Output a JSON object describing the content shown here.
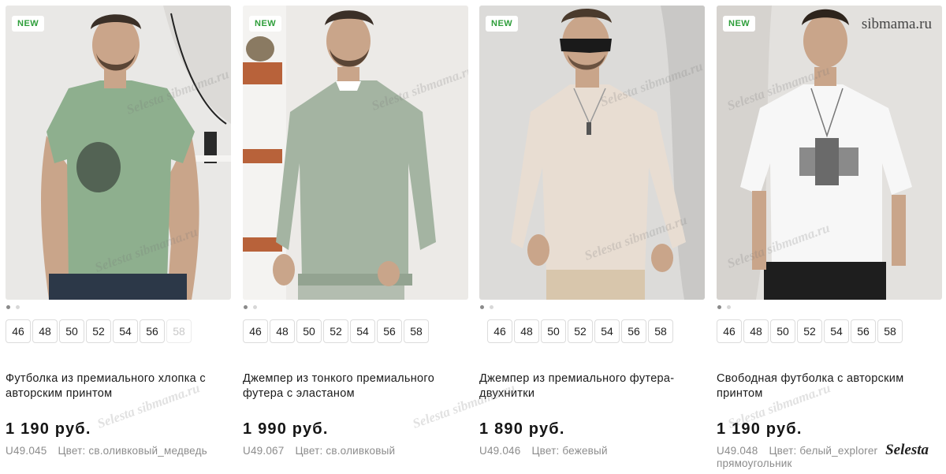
{
  "products": [
    {
      "badge": "NEW",
      "sizes": [
        "46",
        "48",
        "50",
        "52",
        "54",
        "56",
        "58"
      ],
      "sizes_unavailable": [
        "58"
      ],
      "title": "Футболка из премиального хлопка с авторским принтом",
      "price": "1 190 руб.",
      "sku": "U49.045",
      "color": "Цвет: св.оливковый_медведь"
    },
    {
      "badge": "NEW",
      "sizes": [
        "46",
        "48",
        "50",
        "52",
        "54",
        "56",
        "58"
      ],
      "sizes_unavailable": [],
      "title": "Джемпер из тонкого премиального футера с эластаном",
      "price": "1 990 руб.",
      "sku": "U49.067",
      "color": "Цвет: св.оливковый"
    },
    {
      "badge": "NEW",
      "sizes": [
        "46",
        "48",
        "50",
        "52",
        "54",
        "56",
        "58"
      ],
      "sizes_unavailable": [],
      "title": "Джемпер из премиального футера-двухнитки",
      "price": "1 890 руб.",
      "sku": "U49.046",
      "color": "Цвет: бежевый"
    },
    {
      "badge": "NEW",
      "sizes": [
        "46",
        "48",
        "50",
        "52",
        "54",
        "56",
        "58"
      ],
      "sizes_unavailable": [],
      "title": "Свободная футболка с авторским принтом",
      "price": "1 190 руб.",
      "sku": "U49.048",
      "color": "Цвет: белый_explorer прямоугольник"
    }
  ],
  "watermarks": {
    "top_right": "sibmama.ru",
    "bottom_right": "Selesta",
    "overlay": "Selesta sibmama.ru"
  },
  "colors": {
    "badge_text": "#2e9e3a",
    "muted_text": "#8c8c8c"
  }
}
